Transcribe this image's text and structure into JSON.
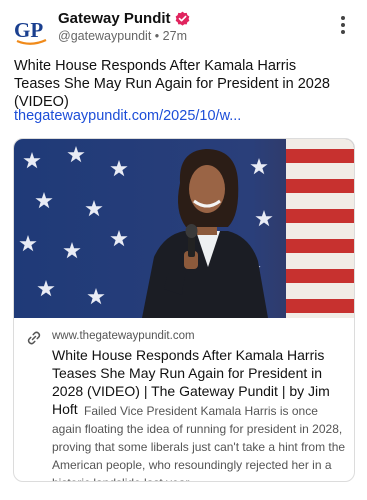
{
  "header": {
    "avatar_text": "GP",
    "account_name": "Gateway Pundit",
    "handle": "@gatewaypundit",
    "separator": "•",
    "time_ago": "27m"
  },
  "post": {
    "text": "White House Responds After Kamala Harris Teases She May Run Again for President in 2028 (VIDEO)",
    "link_text": "thegatewaypundit.com/2025/10/w..."
  },
  "link_card": {
    "domain": "www.thegatewaypundit.com",
    "title": "White House Responds After Kamala Harris Teases She May Run Again for President in 2028 (VIDEO) | The Gateway Pundit | by Jim Hoft",
    "description": "Failed Vice President Kamala Harris is once again floating the idea of running for president in 2028, proving that some liberals just can't take a hint from the American people, who resoundingly rejected her in a historic landslide last year."
  },
  "colors": {
    "avatar_blue": "#1a3f8f",
    "avatar_orange": "#f08a1a",
    "verified_badge": "#e0245e",
    "link_blue": "#1d4ed8"
  },
  "icons": {
    "verified": "verified-badge-icon",
    "more": "kebab-menu-icon",
    "link": "chain-link-icon"
  }
}
